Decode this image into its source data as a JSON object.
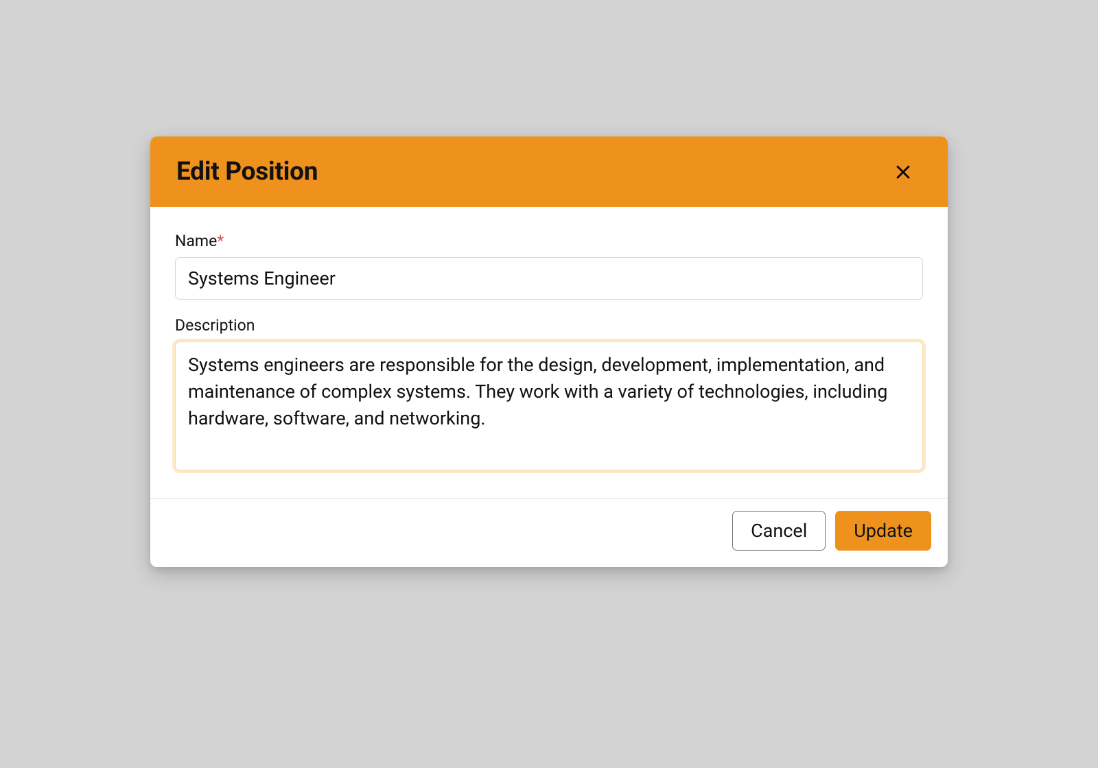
{
  "modal": {
    "title": "Edit Position",
    "fields": {
      "name": {
        "label": "Name",
        "required": "*",
        "value": "Systems Engineer"
      },
      "description": {
        "label": "Description",
        "value": "Systems engineers are responsible for the design, development, implementation, and maintenance of complex systems. They work with a variety of technologies, including hardware, software, and networking."
      }
    },
    "buttons": {
      "cancel": "Cancel",
      "update": "Update"
    }
  }
}
